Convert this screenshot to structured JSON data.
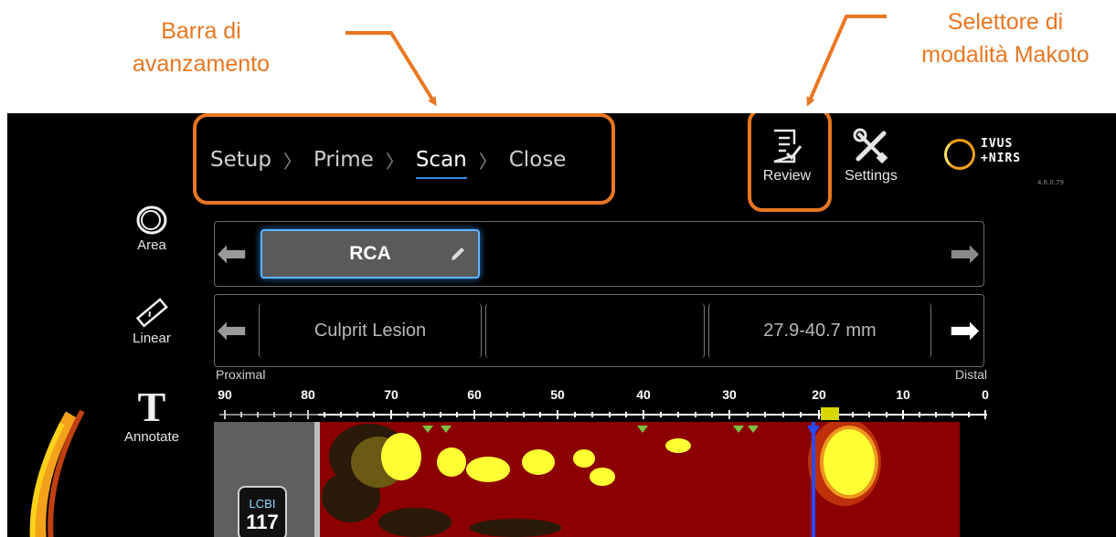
{
  "callouts": {
    "progress_bar": [
      "Barra di",
      "avanzamento"
    ],
    "mode_selector": [
      "Selettore di",
      "modalità Makoto"
    ]
  },
  "colors": {
    "callout": "#e87722",
    "active_underline": "#2f8fe8",
    "background": "#000000",
    "heatmap_base": "#8b0000",
    "heatmap_hot": "#ffff33",
    "marker_green": "#7fc241",
    "cursor_blue": "#2a4bff"
  },
  "progress": {
    "steps": [
      "Setup",
      "Prime",
      "Scan",
      "Close"
    ],
    "active_step": "Scan"
  },
  "toolbar": {
    "review_label": "Review",
    "review_icon": "review-checklist-icon",
    "settings_label": "Settings",
    "settings_icon": "wrench-screwdriver-icon"
  },
  "logo": {
    "line1": "IVUS",
    "line2": "+NIRS",
    "version": "4.6.0.79"
  },
  "tools": {
    "area_label": "Area",
    "linear_label": "Linear",
    "annotate_label": "Annotate",
    "annotate_glyph": "T"
  },
  "vessel": {
    "name": "RCA",
    "edit_icon": "pencil-icon"
  },
  "segment": {
    "name": "Culprit Lesion",
    "middle": "",
    "range": "27.9-40.7 mm"
  },
  "axis": {
    "left_label": "Proximal",
    "right_label": "Distal",
    "ticks": [
      "90",
      "80",
      "70",
      "60",
      "50",
      "40",
      "30",
      "20",
      "10",
      "0"
    ],
    "range_mm": [
      90,
      0
    ]
  },
  "lcbi": {
    "label": "LCBI",
    "value": "117"
  }
}
